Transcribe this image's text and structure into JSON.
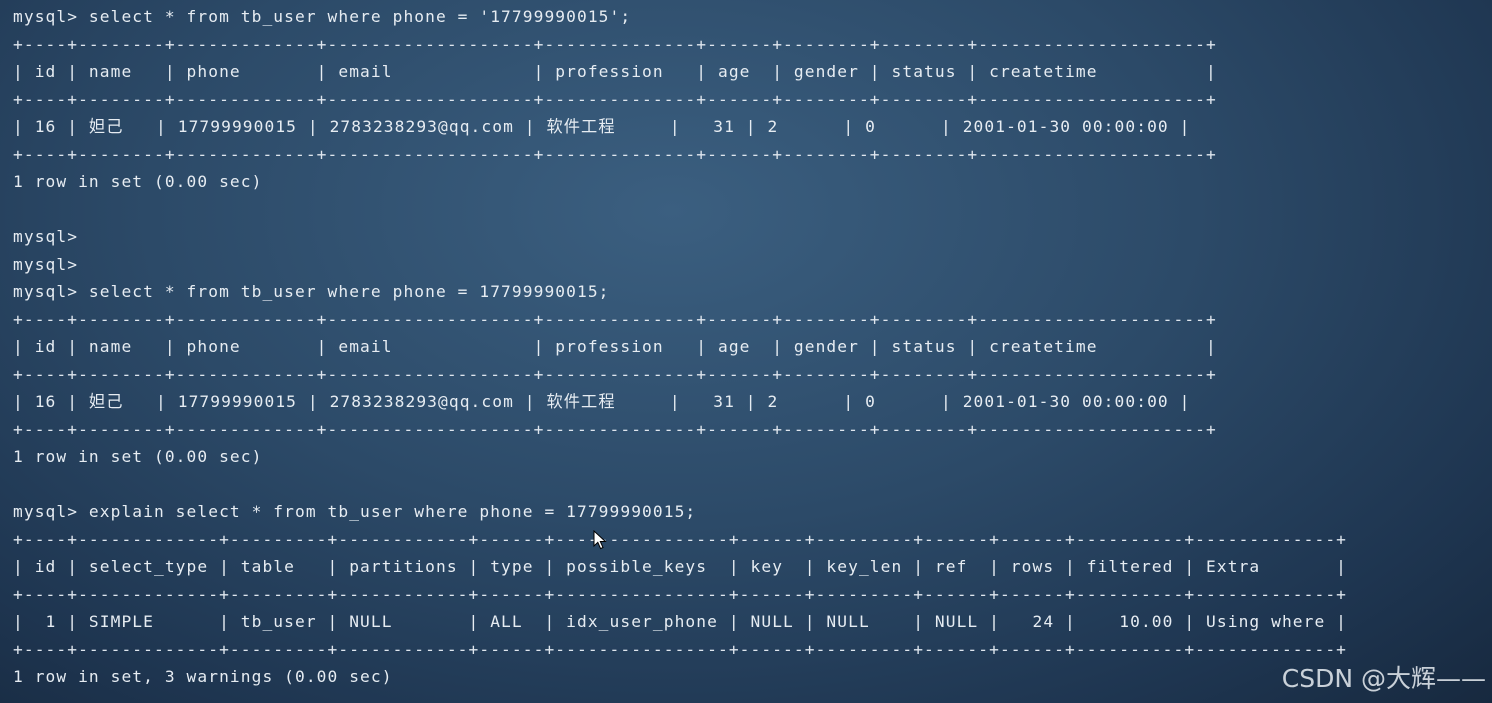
{
  "terminal": {
    "lines": [
      "mysql> select * from tb_user where phone = '17799990015';",
      "+----+--------+-------------+-------------------+--------------+------+--------+--------+---------------------+",
      "| id | name   | phone       | email             | profession   | age  | gender | status | createtime          |",
      "+----+--------+-------------+-------------------+--------------+------+--------+--------+---------------------+",
      "| 16 | 妲己   | 17799990015 | 2783238293@qq.com | 软件工程     |   31 | 2      | 0      | 2001-01-30 00:00:00 |",
      "+----+--------+-------------+-------------------+--------------+------+--------+--------+---------------------+",
      "1 row in set (0.00 sec)",
      "",
      "mysql>",
      "mysql>",
      "mysql> select * from tb_user where phone = 17799990015;",
      "+----+--------+-------------+-------------------+--------------+------+--------+--------+---------------------+",
      "| id | name   | phone       | email             | profession   | age  | gender | status | createtime          |",
      "+----+--------+-------------+-------------------+--------------+------+--------+--------+---------------------+",
      "| 16 | 妲己   | 17799990015 | 2783238293@qq.com | 软件工程     |   31 | 2      | 0      | 2001-01-30 00:00:00 |",
      "+----+--------+-------------+-------------------+--------------+------+--------+--------+---------------------+",
      "1 row in set (0.00 sec)",
      "",
      "mysql> explain select * from tb_user where phone = 17799990015;",
      "+----+-------------+---------+------------+------+----------------+------+---------+------+------+----------+-------------+",
      "| id | select_type | table   | partitions | type | possible_keys  | key  | key_len | ref  | rows | filtered | Extra       |",
      "+----+-------------+---------+------------+------+----------------+------+---------+------+------+----------+-------------+",
      "|  1 | SIMPLE      | tb_user | NULL       | ALL  | idx_user_phone | NULL | NULL    | NULL |   24 |    10.00 | Using where |",
      "+----+-------------+---------+------------+------+----------------+------+---------+------+------+----------+-------------+",
      "1 row in set, 3 warnings (0.00 sec)"
    ]
  },
  "watermark": {
    "text": "CSDN @大辉——"
  },
  "colors": {
    "text": "#e6ecf2",
    "background": "#2c4a68"
  },
  "icons": {
    "cursor": "mouse-pointer-icon"
  }
}
